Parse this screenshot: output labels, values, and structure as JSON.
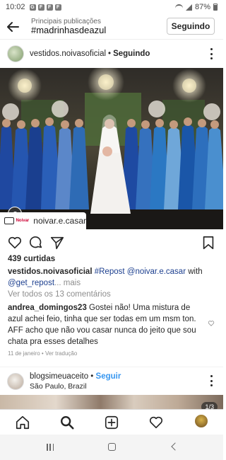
{
  "status_bar": {
    "time": "10:02",
    "battery": "87%",
    "app_icons": [
      "G",
      "F",
      "F",
      "F"
    ]
  },
  "header": {
    "subtitle": "Principais publicações",
    "title": "#madrinhasdeazul",
    "follow_button": "Seguindo"
  },
  "post": {
    "username": "vestidos.noivasoficial",
    "follow_state": "Seguindo",
    "tag_user": "noivar.e.casar",
    "tag_logo": "Noivar",
    "likes": "439 curtidas",
    "caption": {
      "user": "vestidos.noivasoficial",
      "hashtag": "#Repost",
      "mention": "@noivar.e.casar",
      "with": "with",
      "mention2": "@get_repost",
      "more": "... mais"
    },
    "view_all_comments": "Ver todos os 13 comentários",
    "comment": {
      "user": "andrea_domingos23",
      "text": "Gostei não! Uma mistura de azul achei feio, tinha que ser todas em um msm ton. AFF acho que não vou casar nunca do jeito que sou chata pra esses detalhes"
    },
    "comment_date": "11 de janeiro",
    "comment_translate": "Ver tradução"
  },
  "next_post": {
    "username": "blogsimeuaceito",
    "follow_label": "Seguir",
    "location": "São Paulo, Brazil",
    "pager": "1/3"
  },
  "icons": {
    "back": "arrow-left-icon",
    "like": "heart-icon",
    "comment": "comment-icon",
    "share": "send-icon",
    "save": "bookmark-icon",
    "home": "home-icon",
    "search": "search-icon",
    "new_post": "plus-square-icon",
    "activity": "heart-icon",
    "profile": "avatar"
  },
  "colors": {
    "link": "#1c3f8f",
    "follow_blue": "#3897f0",
    "muted": "#8e8e8e",
    "dress_blue": "#1d4fa3"
  }
}
